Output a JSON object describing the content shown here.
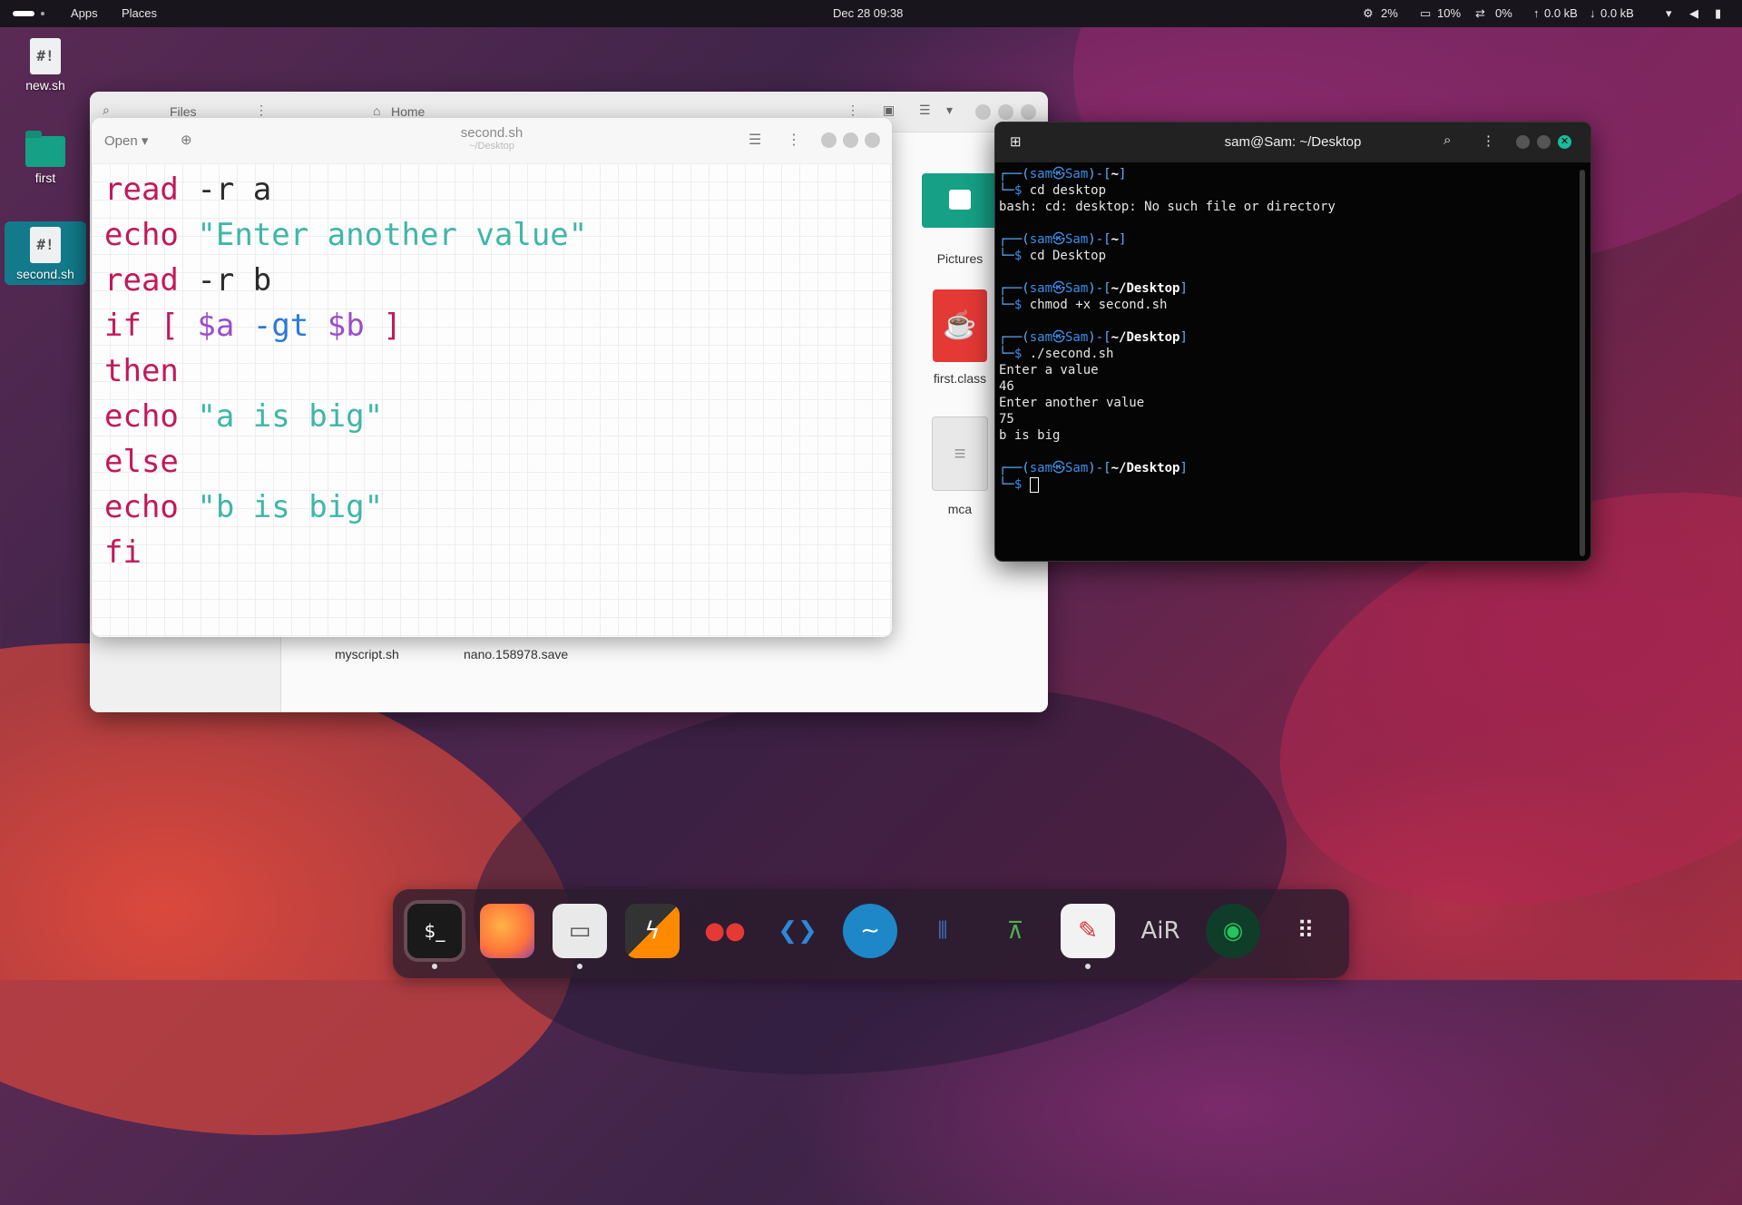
{
  "topbar": {
    "apps": "Apps",
    "places": "Places",
    "datetime": "Dec 28  09:38",
    "cpu": "2%",
    "mem": "10%",
    "swap": "0%",
    "up": "0.0 kB",
    "down": "0.0 kB"
  },
  "desktop": {
    "icons": [
      {
        "label": "new.sh",
        "glyph": "#!"
      },
      {
        "label": "first"
      },
      {
        "label": "second.sh",
        "glyph": "#!"
      }
    ]
  },
  "files": {
    "title": "Files",
    "location": "Home",
    "items": [
      {
        "label": "Pictures"
      },
      {
        "label": "first.class"
      },
      {
        "label": "mca"
      }
    ],
    "list": [
      "myscript.sh",
      "nano.158978.save"
    ]
  },
  "editor": {
    "open_label": "Open",
    "filename": "second.sh",
    "path": "~/Desktop",
    "code": [
      {
        "parts": [
          [
            "kw",
            "read"
          ],
          [
            "plain",
            " -r a"
          ]
        ]
      },
      {
        "parts": [
          [
            "kw",
            "echo"
          ],
          [
            "plain",
            " "
          ],
          [
            "str",
            "\"Enter another value\""
          ]
        ]
      },
      {
        "parts": [
          [
            "kw",
            "read"
          ],
          [
            "plain",
            " -r b"
          ]
        ]
      },
      {
        "parts": [
          [
            "kw",
            "if"
          ],
          [
            "plain",
            " "
          ],
          [
            "br",
            "["
          ],
          [
            "plain",
            " "
          ],
          [
            "var",
            "$a"
          ],
          [
            "plain",
            " "
          ],
          [
            "op",
            "-gt"
          ],
          [
            "plain",
            " "
          ],
          [
            "var",
            "$b"
          ],
          [
            "plain",
            " "
          ],
          [
            "br",
            "]"
          ]
        ]
      },
      {
        "parts": [
          [
            "kw",
            "then"
          ]
        ]
      },
      {
        "parts": [
          [
            "kw",
            "echo"
          ],
          [
            "plain",
            " "
          ],
          [
            "str",
            "\"a is big\""
          ]
        ]
      },
      {
        "parts": [
          [
            "kw",
            "else"
          ]
        ]
      },
      {
        "parts": [
          [
            "kw",
            "echo"
          ],
          [
            "plain",
            " "
          ],
          [
            "str",
            "\"b is big\""
          ]
        ]
      },
      {
        "parts": [
          [
            "kw",
            "fi"
          ]
        ]
      }
    ]
  },
  "terminal": {
    "title": "sam@Sam: ~/Desktop",
    "lines": [
      {
        "t": "prompt",
        "dir": "~"
      },
      {
        "t": "cmd",
        "text": "cd desktop"
      },
      {
        "t": "out",
        "text": "bash: cd: desktop: No such file or directory"
      },
      {
        "t": "blank"
      },
      {
        "t": "prompt",
        "dir": "~"
      },
      {
        "t": "cmd",
        "text": "cd Desktop"
      },
      {
        "t": "blank"
      },
      {
        "t": "prompt",
        "dir": "~/Desktop"
      },
      {
        "t": "cmd",
        "text": "chmod +x second.sh"
      },
      {
        "t": "blank"
      },
      {
        "t": "prompt",
        "dir": "~/Desktop"
      },
      {
        "t": "cmd",
        "text": "./second.sh"
      },
      {
        "t": "out",
        "text": "Enter a value"
      },
      {
        "t": "out",
        "text": "46"
      },
      {
        "t": "out",
        "text": "Enter another value"
      },
      {
        "t": "out",
        "text": "75"
      },
      {
        "t": "out",
        "text": "b is big"
      },
      {
        "t": "blank"
      },
      {
        "t": "prompt",
        "dir": "~/Desktop"
      },
      {
        "t": "cursor"
      }
    ],
    "user": "sam",
    "host": "Sam"
  },
  "dock": {
    "icons": [
      "terminal-icon",
      "firefox-icon",
      "files-icon",
      "sublime-icon",
      "cherrytree-icon",
      "vscode-icon",
      "wireshark-icon",
      "mixer-icon",
      "radio-icon",
      "editor-icon",
      "aircrack-icon",
      "hacker-icon",
      "app-grid-icon"
    ],
    "colors": {
      "terminal": "#1a1a1a",
      "firefox": "#ff7139",
      "files": "#e9e9e9",
      "sublime": "#ff8a00",
      "cherry": "#e53935",
      "vscode": "#2b8ad8",
      "wireshark": "#1d87c8",
      "mixer": "#3b6fb6",
      "radio": "#4caf50",
      "editor": "#f2f2f2",
      "air": "#d0d0d0",
      "hacker": "#22c55e"
    }
  }
}
